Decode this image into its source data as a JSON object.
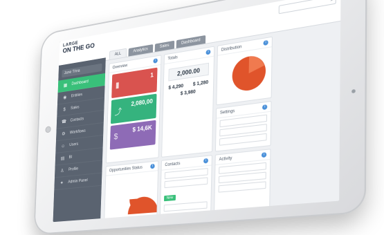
{
  "brand": {
    "top": "LARGE",
    "main": "ON THE GO"
  },
  "user": {
    "name": "Jane Trina"
  },
  "sidebar": {
    "items": [
      {
        "label": "Dashboard",
        "icon": "dashboard-icon",
        "glyph": "▦",
        "active": true
      },
      {
        "label": "Entities",
        "icon": "entities-icon",
        "glyph": "◉",
        "active": false
      },
      {
        "label": "Sales",
        "icon": "sales-icon",
        "glyph": "$",
        "active": false
      },
      {
        "label": "Contacts",
        "icon": "contacts-icon",
        "glyph": "☎",
        "active": false
      },
      {
        "label": "Workflows",
        "icon": "workflows-icon",
        "glyph": "⚙",
        "active": false
      },
      {
        "label": "Users",
        "icon": "users-icon",
        "glyph": "☺",
        "active": false
      },
      {
        "label": "BI",
        "icon": "bi-icon",
        "glyph": "▤",
        "active": false
      },
      {
        "label": "Profile",
        "icon": "profile-icon",
        "glyph": "♙",
        "active": false
      },
      {
        "label": "Admin Panel",
        "icon": "admin-icon",
        "glyph": "✦",
        "active": false
      }
    ]
  },
  "tabs": [
    {
      "label": "ALL",
      "active": true
    },
    {
      "label": "Analytics",
      "active": false
    },
    {
      "label": "Sales",
      "active": false
    },
    {
      "label": "Dashboard",
      "active": false
    }
  ],
  "panels": {
    "stats": {
      "title": "Overview",
      "cards": [
        {
          "value": "1",
          "label": "",
          "color": "#d9534f"
        },
        {
          "value": "2,080,00",
          "label": "",
          "color": "#35b37e"
        },
        {
          "value": "$ 14,6K",
          "label": "",
          "color": "#8e6bb6"
        }
      ]
    },
    "totals": {
      "title": "Totals",
      "big": "2,000.00",
      "left": "$ 4,290",
      "right": "$ 1,280",
      "bottom": "$ 3,980"
    },
    "pie": {
      "title": "Distribution"
    },
    "activity": {
      "title": "Activity"
    },
    "form": {
      "title": "Contacts",
      "chip": "New"
    },
    "mini": {
      "title": "Settings"
    },
    "bottom_left": {
      "title": "Opportunities Status"
    }
  },
  "colors": {
    "accent": "#39c07a",
    "sidebar": "#5a6370",
    "pie": "#e0542b"
  }
}
